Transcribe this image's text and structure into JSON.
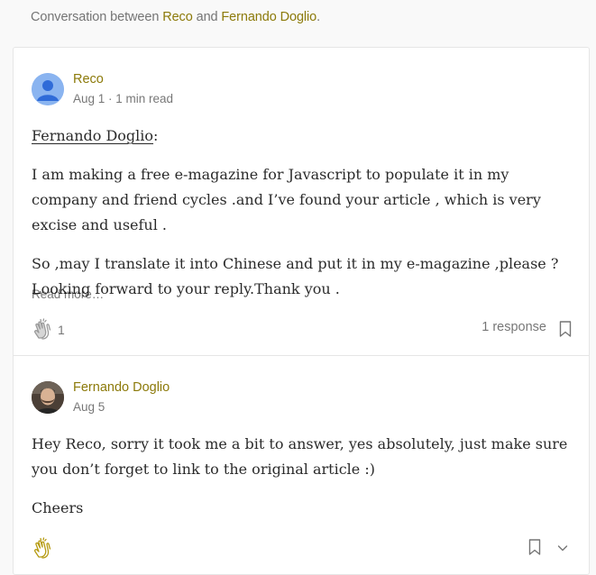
{
  "header": {
    "prefix": "Conversation between ",
    "author1": "Reco",
    "conjunction": " and ",
    "author2": "Fernando Doglio",
    "suffix": "."
  },
  "responses": [
    {
      "author": "Reco",
      "date": "Aug 1",
      "separator": " · ",
      "read_time": "1 min read",
      "mention": "Fernando Doglio",
      "mention_suffix": ":",
      "paragraphs": [
        "I am making a free e-magazine for Javascript to populate it in my company and friend cycles .and I’ve found your article , which is very excise and useful .",
        "So ,may I translate it into Chinese and put it in my e-magazine ,please ? Looking forward to your reply.Thank you ."
      ],
      "read_more": "Read more…",
      "clap_count": "1",
      "response_count": "1 response",
      "icons": [
        "avatar-default",
        "clap-icon",
        "bookmark-icon"
      ]
    },
    {
      "author": "Fernando Doglio",
      "date": "Aug 5",
      "paragraphs": [
        "Hey Reco, sorry it took me a bit to answer, yes absolutely, just make sure you don’t forget to link to the original article :)",
        "Cheers"
      ],
      "icons": [
        "avatar-photo",
        "clap-icon",
        "bookmark-icon",
        "chevron-down-icon"
      ]
    }
  ],
  "colors": {
    "author_link": "#8c7a0a",
    "muted": "#757575",
    "clap_active": "#b59a10"
  }
}
